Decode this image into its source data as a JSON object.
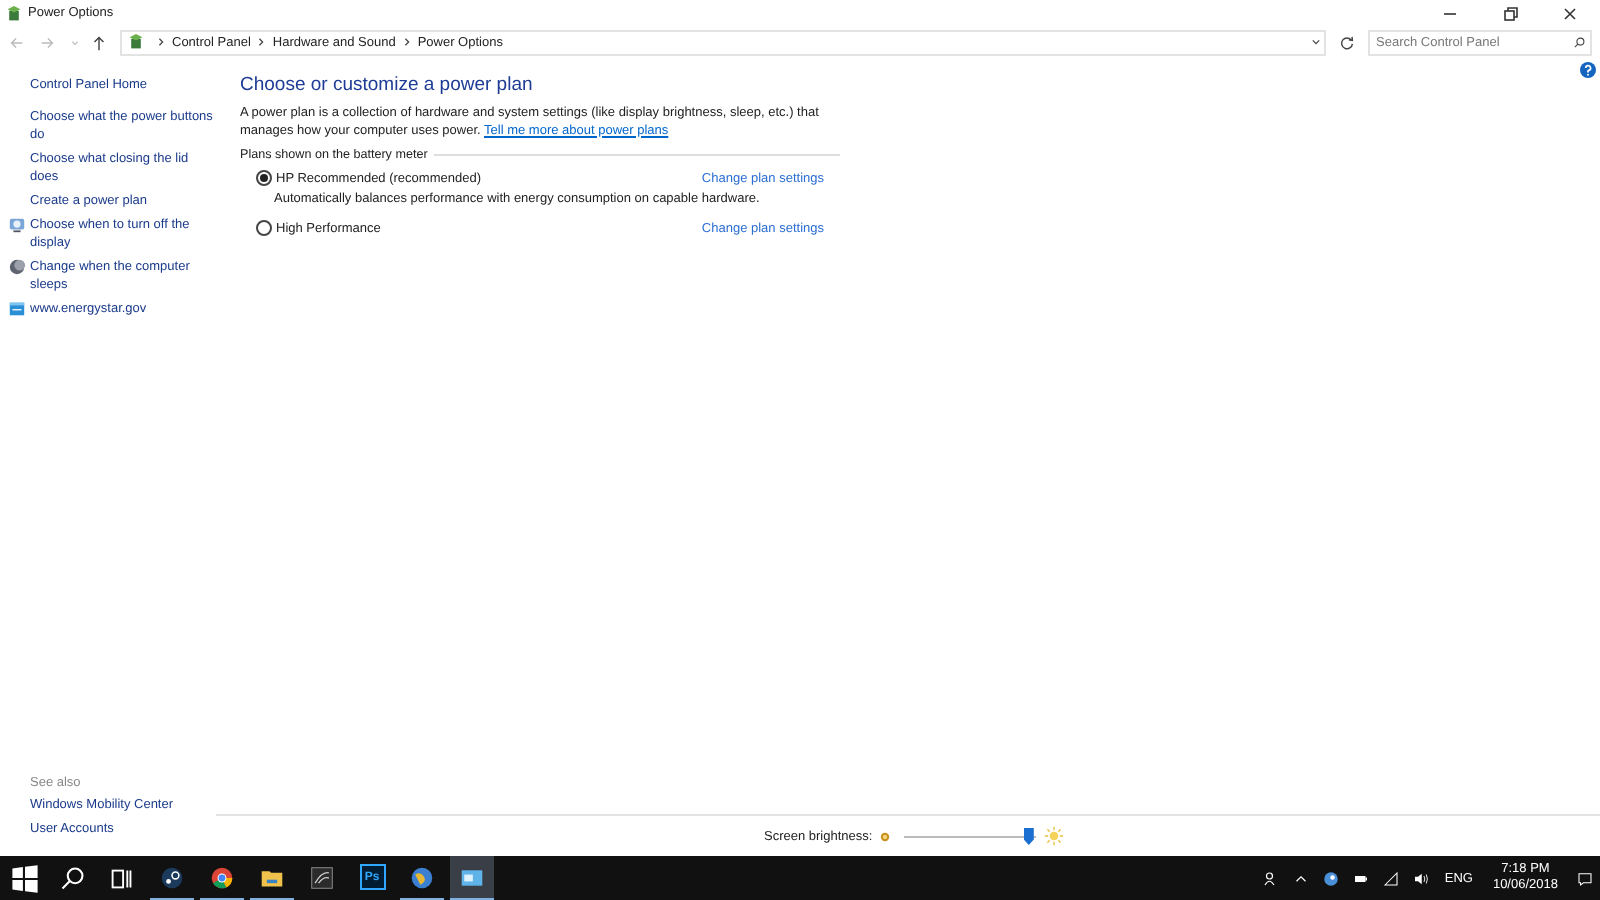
{
  "window": {
    "title": "Power Options"
  },
  "breadcrumb": [
    "Control Panel",
    "Hardware and Sound",
    "Power Options"
  ],
  "search": {
    "placeholder": "Search Control Panel"
  },
  "sidebar": {
    "home": "Control Panel Home",
    "items": [
      {
        "label": "Choose what the power buttons do",
        "kind": "plain"
      },
      {
        "label": "Choose what closing the lid does",
        "kind": "plain"
      },
      {
        "label": "Create a power plan",
        "kind": "plain"
      },
      {
        "label": "Choose when to turn off the display",
        "kind": "monitor"
      },
      {
        "label": "Change when the computer sleeps",
        "kind": "moon"
      },
      {
        "label": "www.energystar.gov",
        "kind": "web"
      }
    ],
    "see_also_heading": "See also",
    "see_also": [
      "Windows Mobility Center",
      "User Accounts"
    ]
  },
  "main": {
    "heading": "Choose or customize a power plan",
    "intro": "A power plan is a collection of hardware and system settings (like display brightness, sleep, etc.) that manages how your computer uses power.",
    "intro_link": "Tell me more about power plans",
    "group_label": "Plans shown on the battery meter",
    "plans": [
      {
        "name": "HP Recommended (recommended)",
        "selected": true,
        "description": "Automatically balances performance with energy consumption on capable hardware.",
        "link": "Change plan settings"
      },
      {
        "name": "High Performance",
        "selected": false,
        "link": "Change plan settings"
      }
    ]
  },
  "brightness": {
    "label": "Screen brightness:",
    "level": 0.95
  },
  "taskbar": {
    "apps": [
      {
        "kind": "steam",
        "running": true,
        "selected": false
      },
      {
        "kind": "chrome",
        "running": true,
        "selected": false
      },
      {
        "kind": "folder",
        "running": true,
        "selected": false
      },
      {
        "kind": "nvidia",
        "running": false,
        "selected": false
      },
      {
        "kind": "ps",
        "label": "Ps",
        "running": false,
        "selected": false
      },
      {
        "kind": "globe",
        "running": true,
        "selected": false
      },
      {
        "kind": "panel",
        "running": true,
        "selected": true
      }
    ],
    "language": "ENG",
    "time": "7:18 PM",
    "date": "10/06/2018"
  }
}
